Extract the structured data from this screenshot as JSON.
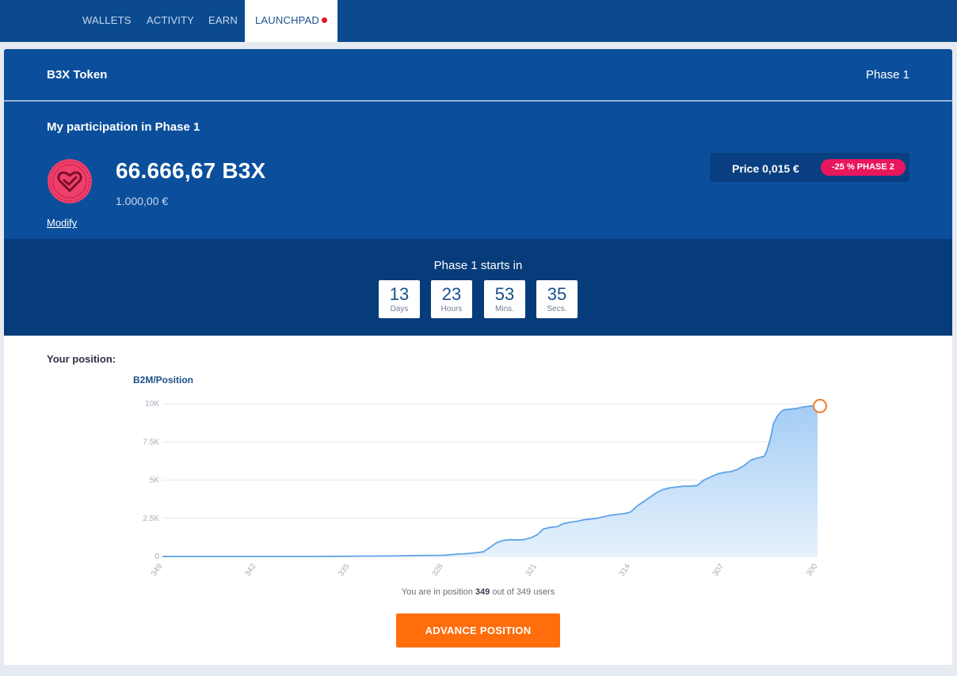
{
  "nav": {
    "items": [
      {
        "label": "WALLETS",
        "active": false
      },
      {
        "label": "ACTIVITY",
        "active": false
      },
      {
        "label": "EARN",
        "active": false
      },
      {
        "label": "LAUNCHPAD",
        "active": true,
        "has_dot": true
      }
    ]
  },
  "card": {
    "token_name": "B3X Token",
    "phase_label": "Phase 1"
  },
  "participation": {
    "title": "My participation in Phase 1",
    "amount": "66.666,67 B3X",
    "fiat": "1.000,00 €",
    "modify_label": "Modify",
    "price": "Price 0,015 €",
    "discount_badge": "-25 % PHASE 2",
    "logo_icon": "heart-logo-icon"
  },
  "countdown": {
    "title": "Phase 1 starts in",
    "units": [
      {
        "value": "13",
        "label": "Days"
      },
      {
        "value": "23",
        "label": "Hours"
      },
      {
        "value": "53",
        "label": "Mins."
      },
      {
        "value": "35",
        "label": "Secs."
      }
    ]
  },
  "position": {
    "heading": "Your position:",
    "prefix": "You are in position ",
    "position_value": "349",
    "suffix": " out of 349 users",
    "button_label": "ADVANCE POSITION"
  },
  "colors": {
    "brand_blue": "#0b4f9c",
    "accent_orange": "#ff6d0d",
    "badge_pink": "#e8175d",
    "line_blue": "#5fa4e6"
  },
  "chart_data": {
    "type": "area",
    "title": "B2M/Position",
    "xlabel": "",
    "ylabel": "",
    "x_reversed": true,
    "xlim": [
      349,
      300
    ],
    "ylim": [
      0,
      10000
    ],
    "y_ticks": [
      "0",
      "2.5K",
      "5K",
      "7.5K",
      "10K"
    ],
    "y_tick_values": [
      0,
      2500,
      5000,
      7500,
      10000
    ],
    "x_ticks": [
      "349",
      "342",
      "335",
      "328",
      "321",
      "314",
      "307",
      "300"
    ],
    "x_tick_values": [
      349,
      342,
      335,
      328,
      321,
      314,
      307,
      300
    ],
    "grid": true,
    "highlight_point": {
      "x": 300,
      "y": 9850
    },
    "series": [
      {
        "x": [
          349,
          348,
          346,
          344,
          342,
          340,
          338,
          336,
          334,
          332,
          330,
          328,
          327,
          326,
          325,
          324,
          323.5,
          323,
          322.5,
          322,
          321.5,
          321,
          320.5,
          320,
          319.5,
          319,
          318.5,
          318,
          317.5,
          317,
          316.5,
          316,
          315.5,
          315,
          314.5,
          314,
          313.5,
          313,
          312.5,
          312,
          311.5,
          311,
          310.5,
          310,
          309.5,
          309,
          308.5,
          308,
          307.5,
          307,
          306.5,
          306,
          305.5,
          305,
          304.5,
          304,
          303.8,
          303.5,
          303.3,
          303,
          302.7,
          302.5,
          302,
          301.5,
          301,
          300.5,
          300
        ],
        "y": [
          0,
          0,
          0,
          0,
          0,
          0,
          0,
          10,
          20,
          30,
          60,
          80,
          150,
          200,
          300,
          900,
          1050,
          1100,
          1080,
          1100,
          1200,
          1400,
          1800,
          1900,
          1950,
          2150,
          2250,
          2300,
          2400,
          2450,
          2500,
          2600,
          2700,
          2750,
          2800,
          2900,
          3300,
          3600,
          3900,
          4200,
          4400,
          4500,
          4550,
          4600,
          4600,
          4650,
          5000,
          5200,
          5400,
          5500,
          5550,
          5700,
          5950,
          6300,
          6450,
          6550,
          6900,
          7800,
          8700,
          9200,
          9500,
          9600,
          9650,
          9700,
          9800,
          9850,
          9850
        ]
      }
    ]
  }
}
